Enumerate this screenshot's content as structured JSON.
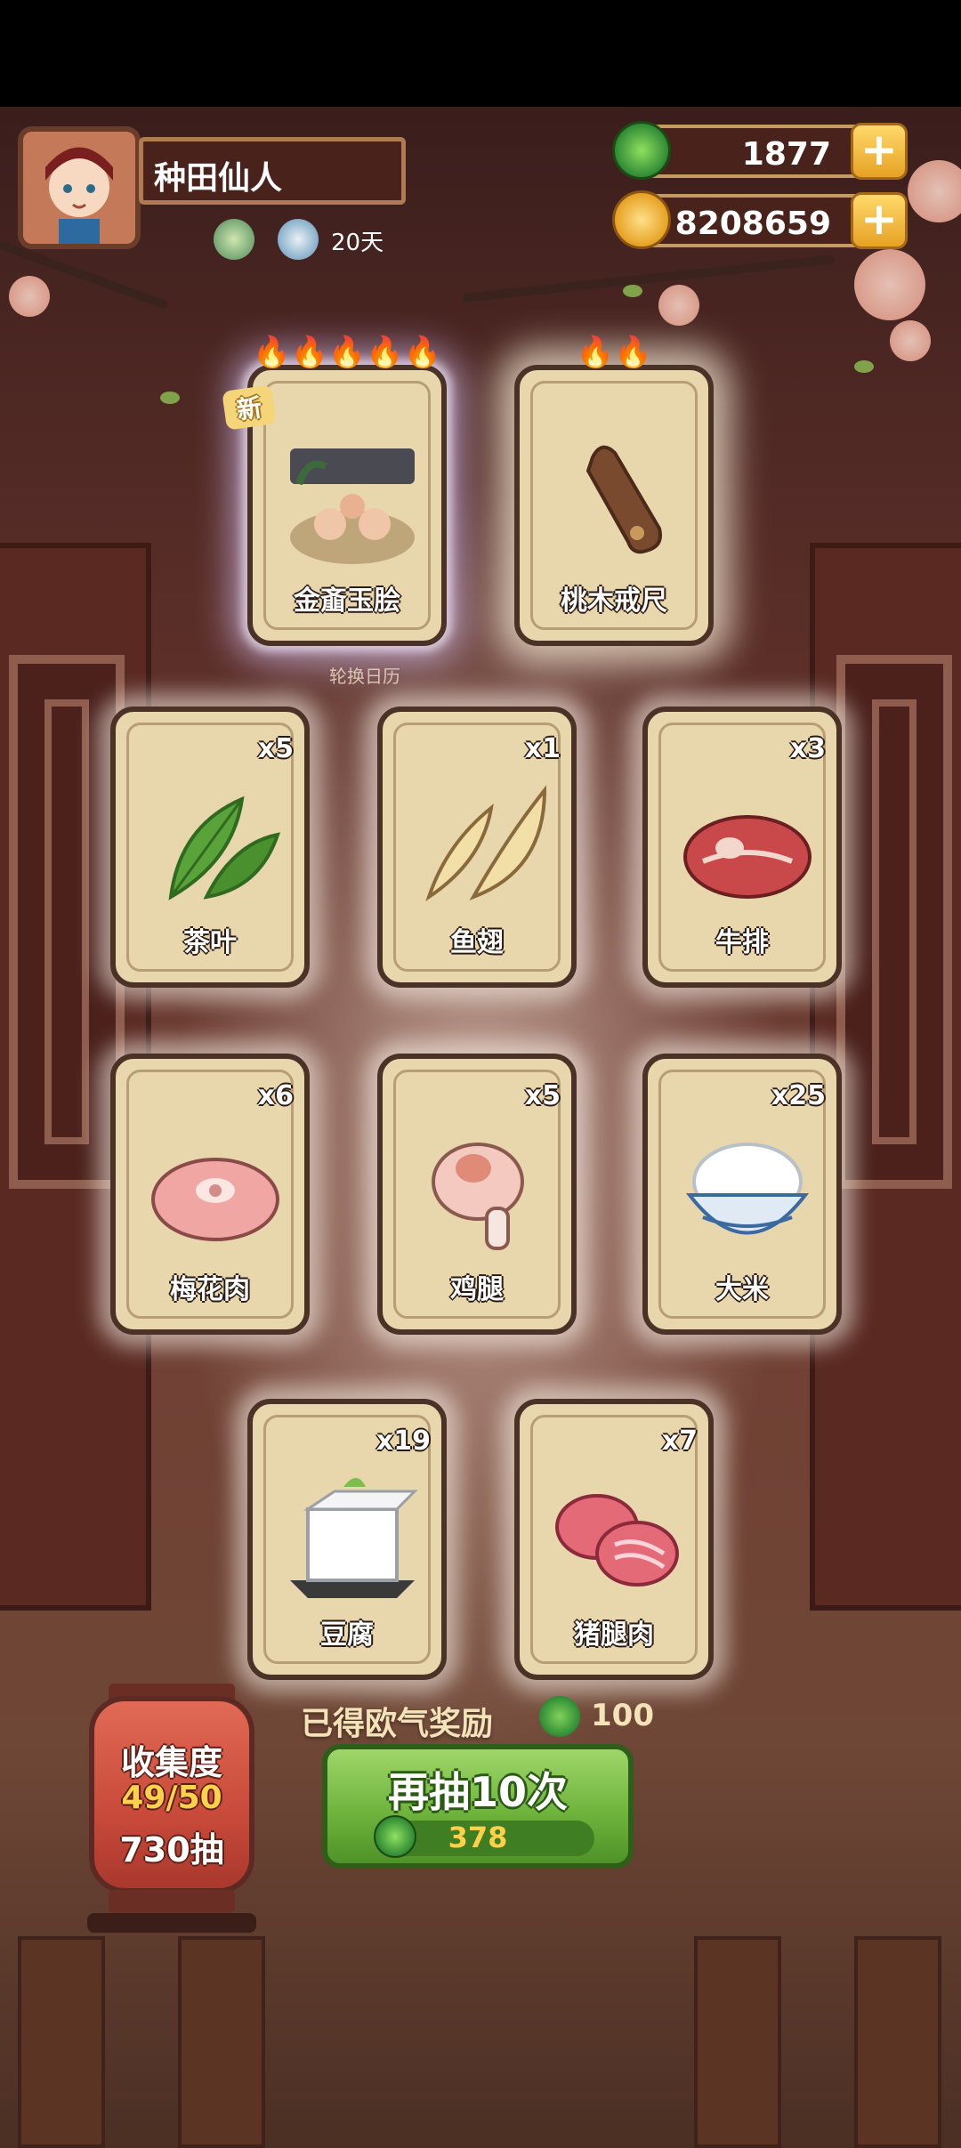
{
  "player": {
    "name": "种田仙人",
    "days": "20天"
  },
  "resources": {
    "jade": "1877",
    "coins": "8208659"
  },
  "featured_cards": [
    {
      "label": "金齑玉脍",
      "stars": 5,
      "new": true,
      "new_label": "新",
      "caption": "轮换日历",
      "art": "dish-icon"
    },
    {
      "label": "桃木戒尺",
      "stars": 2,
      "new": false,
      "art": "ruler-icon"
    }
  ],
  "cards": [
    {
      "label": "茶叶",
      "count": "x5",
      "art": "tea-leaf-icon"
    },
    {
      "label": "鱼翅",
      "count": "x1",
      "art": "shark-fin-icon"
    },
    {
      "label": "牛排",
      "count": "x3",
      "art": "steak-icon"
    },
    {
      "label": "梅花肉",
      "count": "x6",
      "art": "pork-shoulder-icon"
    },
    {
      "label": "鸡腿",
      "count": "x5",
      "art": "drumstick-icon"
    },
    {
      "label": "大米",
      "count": "x25",
      "art": "rice-bowl-icon"
    },
    {
      "label": "豆腐",
      "count": "x19",
      "art": "tofu-icon"
    },
    {
      "label": "猪腿肉",
      "count": "x7",
      "art": "pork-leg-icon"
    }
  ],
  "reward": {
    "text": "已得欧气奖励",
    "value": "100"
  },
  "collection": {
    "title": "收集度",
    "progress": "49/50",
    "draws": "730抽"
  },
  "draw_button": {
    "label": "再抽10次",
    "cost": "378"
  },
  "colors": {
    "jade_green": "#2f8a34",
    "button_green": "#6fb43d",
    "gold": "#e6a223",
    "card_bg": "#e8d7ad"
  }
}
